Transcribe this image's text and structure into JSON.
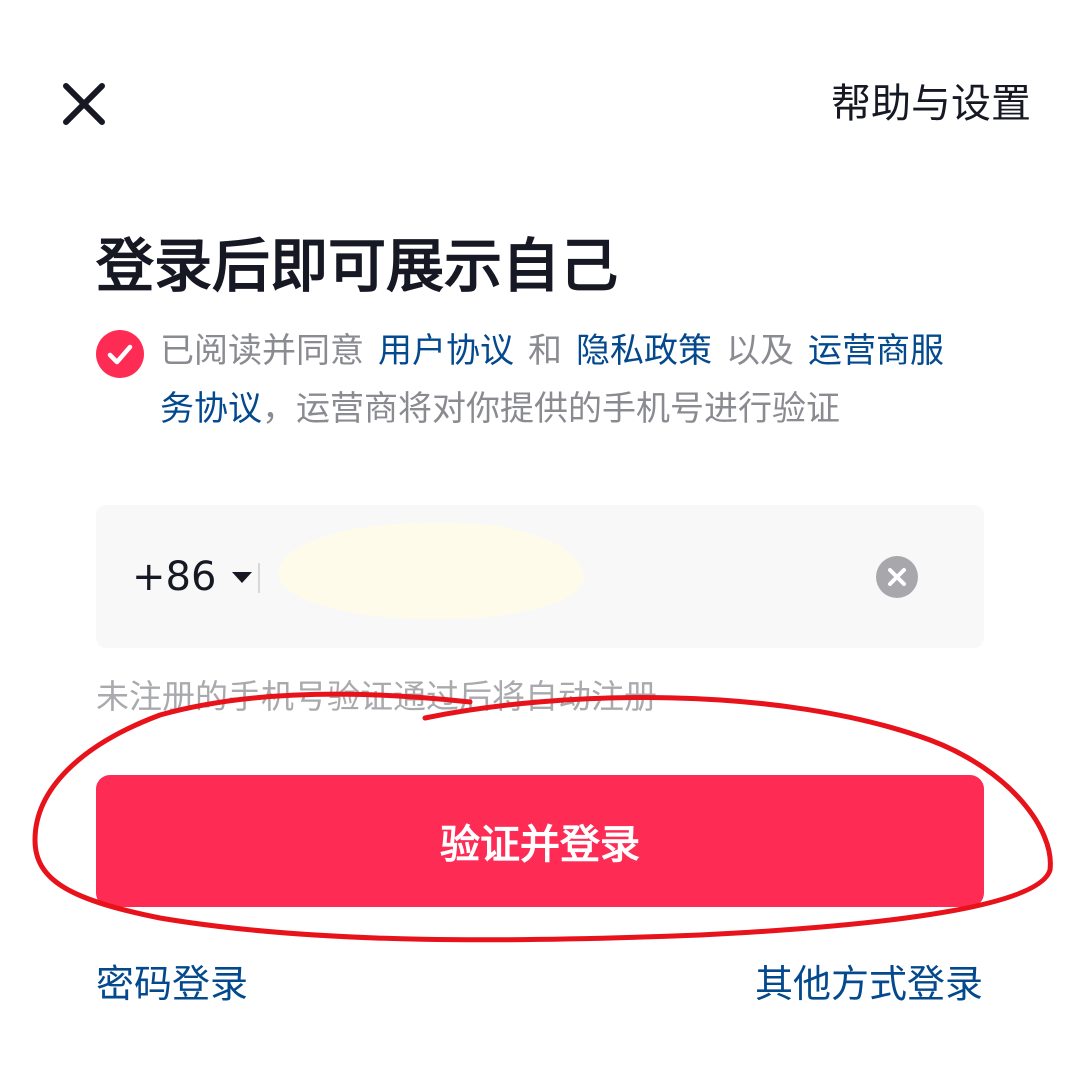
{
  "header": {
    "close_icon": "close-icon",
    "help_label": "帮助与设置"
  },
  "title": "登录后即可展示自己",
  "agreement": {
    "checked": true,
    "checkbox_icon": "check-icon",
    "checkbox_color": "#fe2c55",
    "prefix": "已阅读并同意",
    "link_user": "用户协议",
    "and": "和",
    "link_privacy": "隐私政策",
    "also": "以及",
    "link_carrier": "运营商服务协议",
    "suffix": "，运营商将对你提供的手机号进行验证",
    "link_color": "#04498d"
  },
  "phone": {
    "country_code": "+86",
    "value": "",
    "clear_icon": "clear-icon"
  },
  "hint": "未注册的手机号验证通过后将自动注册",
  "login_button": {
    "label": "验证并登录",
    "color": "#fe2c55"
  },
  "footer": {
    "password_login": "密码登录",
    "other_login": "其他方式登录"
  },
  "annotation_color": "#e8121b"
}
